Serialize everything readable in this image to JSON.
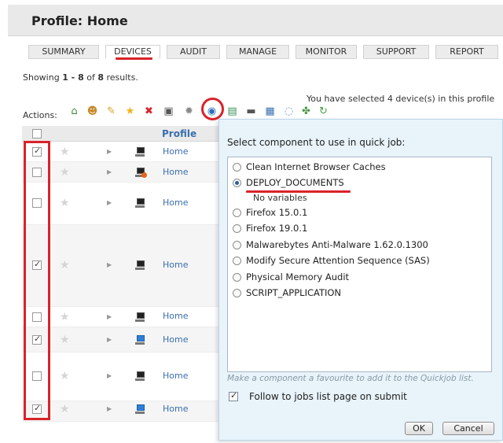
{
  "header": {
    "title": "Profile: Home"
  },
  "tabs": [
    {
      "label": "SUMMARY"
    },
    {
      "label": "DEVICES",
      "active": true
    },
    {
      "label": "AUDIT"
    },
    {
      "label": "MANAGE"
    },
    {
      "label": "MONITOR"
    },
    {
      "label": "SUPPORT"
    },
    {
      "label": "REPORT"
    }
  ],
  "results": {
    "prefix": "Showing ",
    "range": "1 - 8",
    "of": " of ",
    "total": "8",
    "suffix": " results."
  },
  "selection_message": "You have selected 4 device(s) in this profile",
  "actions": {
    "label": "Actions:",
    "icons": [
      "home-icon",
      "users-icon",
      "pencil-icon",
      "star-icon",
      "delete-icon",
      "lock-icon",
      "settings-icon",
      "quick-job-icon",
      "script-icon",
      "monitor-icon",
      "patch-icon",
      "chat-icon",
      "tools-icon",
      "refresh-icon"
    ]
  },
  "table": {
    "profile_header": "Profile",
    "rows": [
      {
        "checked": true,
        "device": "desktop",
        "profile": "Home"
      },
      {
        "checked": false,
        "device": "desktop-alert",
        "profile": "Home"
      },
      {
        "checked": false,
        "device": "desktop",
        "profile": "Home"
      },
      {
        "checked": true,
        "device": "laptop",
        "profile": "Home"
      },
      {
        "checked": false,
        "device": "desktop",
        "profile": "Home"
      },
      {
        "checked": true,
        "device": "desktop-blue",
        "profile": "Home"
      },
      {
        "checked": false,
        "device": "desktop",
        "profile": "Home"
      },
      {
        "checked": true,
        "device": "desktop-blue",
        "profile": "Home"
      }
    ]
  },
  "quickjob_dialog": {
    "heading": "Select component to use in quick job:",
    "options": [
      {
        "label": "Clean Internet Browser Caches",
        "selected": false
      },
      {
        "label": "DEPLOY_DOCUMENTS",
        "selected": true
      },
      {
        "label": "Firefox 15.0.1",
        "selected": false
      },
      {
        "label": "Firefox 19.0.1",
        "selected": false
      },
      {
        "label": "Malwarebytes Anti-Malware 1.62.0.1300",
        "selected": false
      },
      {
        "label": "Modify Secure Attention Sequence (SAS)",
        "selected": false
      },
      {
        "label": "Physical Memory Audit",
        "selected": false
      },
      {
        "label": "SCRIPT_APPLICATION",
        "selected": false
      }
    ],
    "selected_note": "No variables",
    "hint": "Make a component a favourite to add it to the Quickjob list.",
    "follow_label": "Follow to jobs list page on submit",
    "follow_checked": true,
    "ok_label": "OK",
    "cancel_label": "Cancel"
  },
  "colors": {
    "accent_red": "#d9232a",
    "link_blue": "#3a6faf",
    "dialog_bg": "#e8f3fa"
  }
}
